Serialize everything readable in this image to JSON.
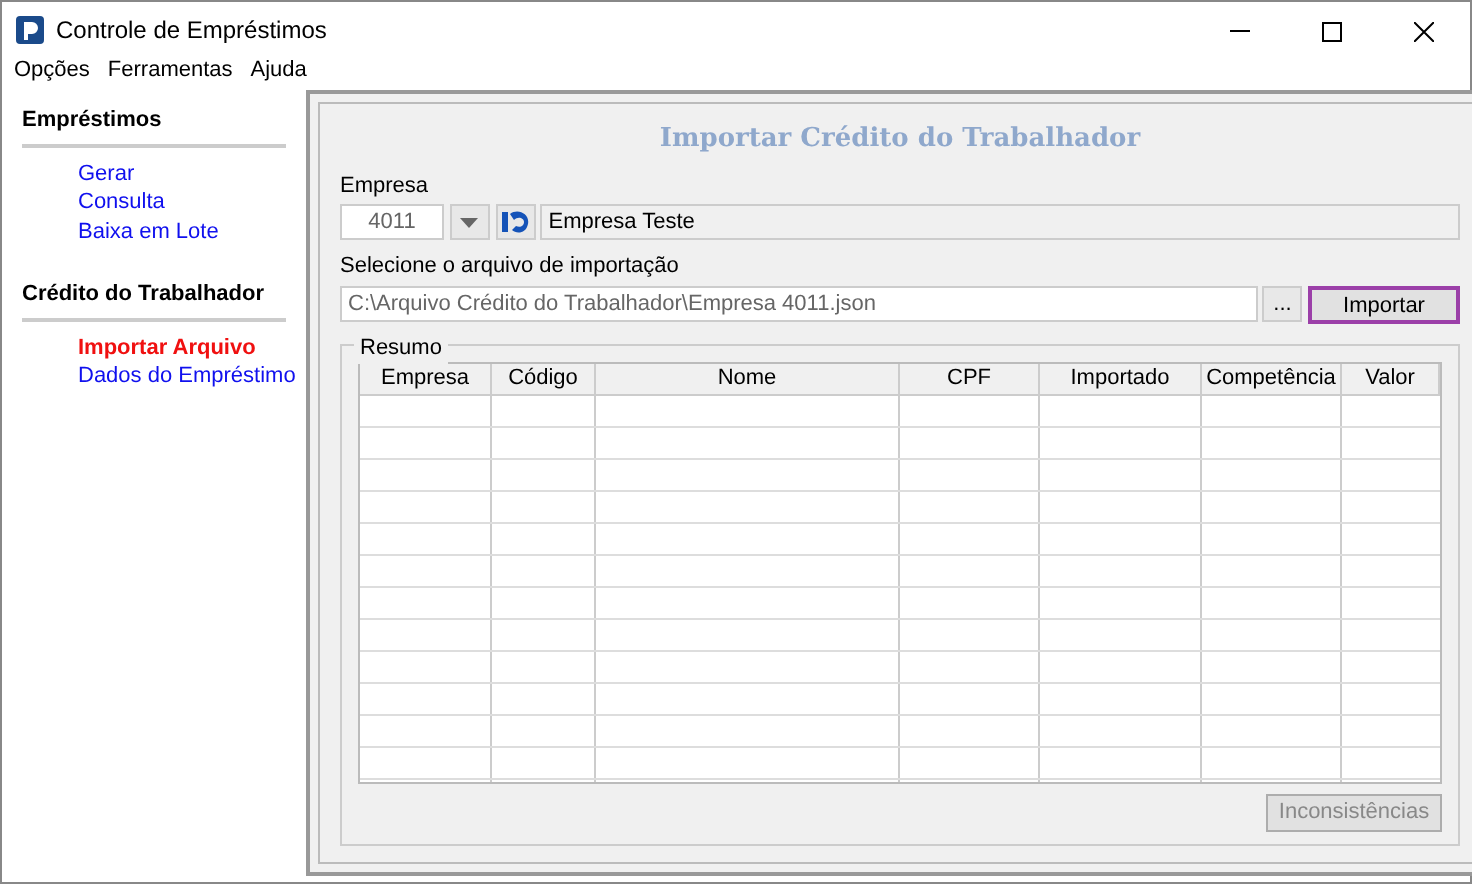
{
  "window": {
    "title": "Controle de Empréstimos"
  },
  "menu": [
    "Opções",
    "Ferramentas",
    "Ajuda"
  ],
  "sidebar": [
    {
      "title": "Empréstimos",
      "items": [
        {
          "label": "Gerar",
          "selected": false
        },
        {
          "label": "Consulta",
          "selected": false
        },
        {
          "label": "Baixa em Lote",
          "selected": false
        }
      ]
    },
    {
      "title": "Crédito do Trabalhador",
      "items": [
        {
          "label": "Importar Arquivo",
          "selected": true
        },
        {
          "label": "Dados do Empréstimo",
          "selected": false
        }
      ]
    }
  ],
  "panel": {
    "title": "Importar Crédito do Trabalhador",
    "empresa": {
      "label": "Empresa",
      "code": "4011",
      "name": "Empresa Teste"
    },
    "file": {
      "label": "Selecione o arquivo de importação",
      "value": "C:\\Arquivo Crédito do Trabalhador\\Empresa 4011.json",
      "browse": "...",
      "button": {
        "label": "Importar",
        "focused": true
      }
    },
    "summary": {
      "title": "Resumo",
      "columns": [
        "Empresa",
        "Código",
        "Nome",
        "CPF",
        "Importado",
        "Competência",
        "Valor"
      ]
    },
    "footer_button": {
      "label": "Inconsistências",
      "disabled": true
    }
  }
}
